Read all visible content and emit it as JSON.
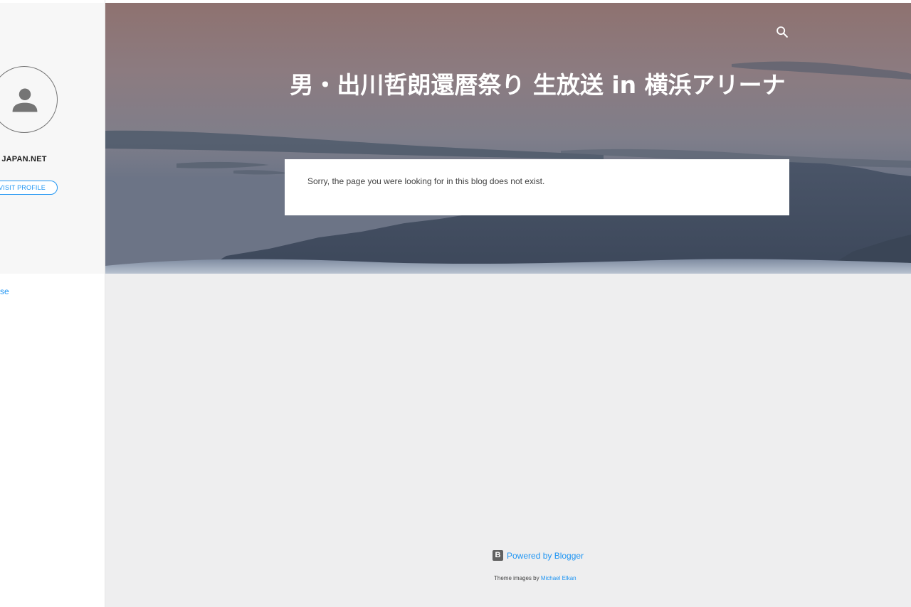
{
  "header": {
    "title": "男・出川哲朗還暦祭り 生放送 in 横浜アリーナ",
    "search_icon": "search-icon"
  },
  "error": {
    "message": "Sorry, the page you were looking for in this blog does not exist."
  },
  "sidebar": {
    "profile_name": "JAPAN.NET",
    "visit_profile_label": "VISIT PROFILE",
    "link_label": "se",
    "avatar_icon": "person-icon"
  },
  "footer": {
    "powered_label": "Powered by Blogger",
    "logo_letter": "B",
    "theme_prefix": "Theme images by ",
    "theme_author": "Michael Elkan"
  },
  "colors": {
    "accent": "#2196f3",
    "card": "#ffffff",
    "main_bg": "#eeeeef",
    "sidebar_bg": "#f7f7f7"
  }
}
